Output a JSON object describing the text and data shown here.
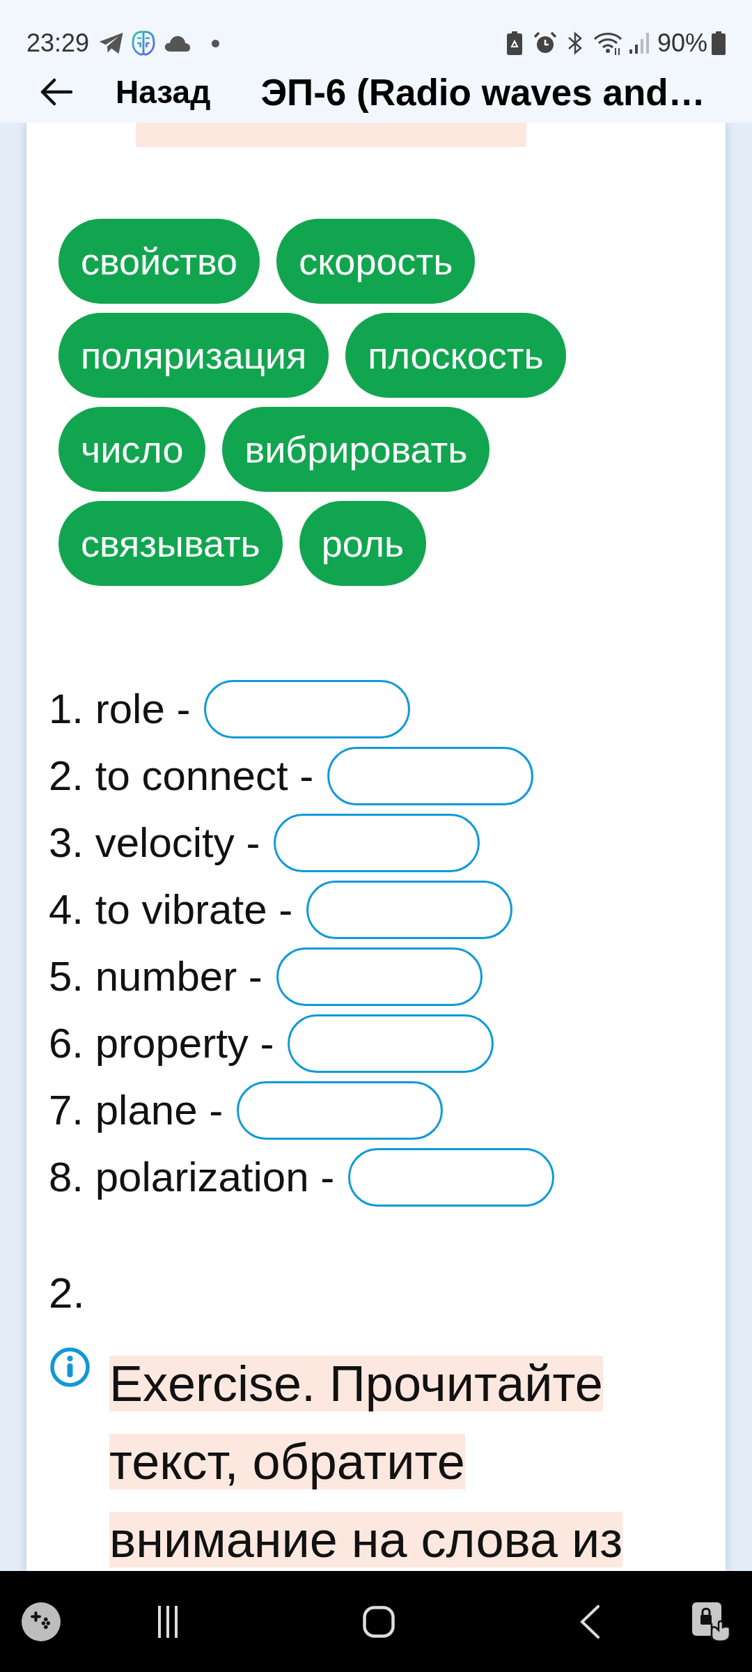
{
  "status_bar": {
    "time": "23:29",
    "battery_text": "90%"
  },
  "header": {
    "back_label": "Назад",
    "title": "ЭП-6 (Radio waves and…"
  },
  "word_bank": [
    {
      "label": "свойство"
    },
    {
      "label": "скорость"
    },
    {
      "label": "поляризация"
    },
    {
      "label": "плоскость"
    },
    {
      "label": "число"
    },
    {
      "label": "вибрировать"
    },
    {
      "label": "связывать"
    },
    {
      "label": "роль"
    }
  ],
  "matching": [
    {
      "prompt": "1. role -"
    },
    {
      "prompt": "2. to connect -"
    },
    {
      "prompt": "3. velocity -"
    },
    {
      "prompt": "4. to vibrate -"
    },
    {
      "prompt": "5. number -"
    },
    {
      "prompt": "6. property -"
    },
    {
      "prompt": "7. plane -"
    },
    {
      "prompt": "8. polarization -"
    }
  ],
  "section": {
    "number": "2.",
    "note": "Exercise. Прочитайте текст, обратите внимание на слова из"
  }
}
